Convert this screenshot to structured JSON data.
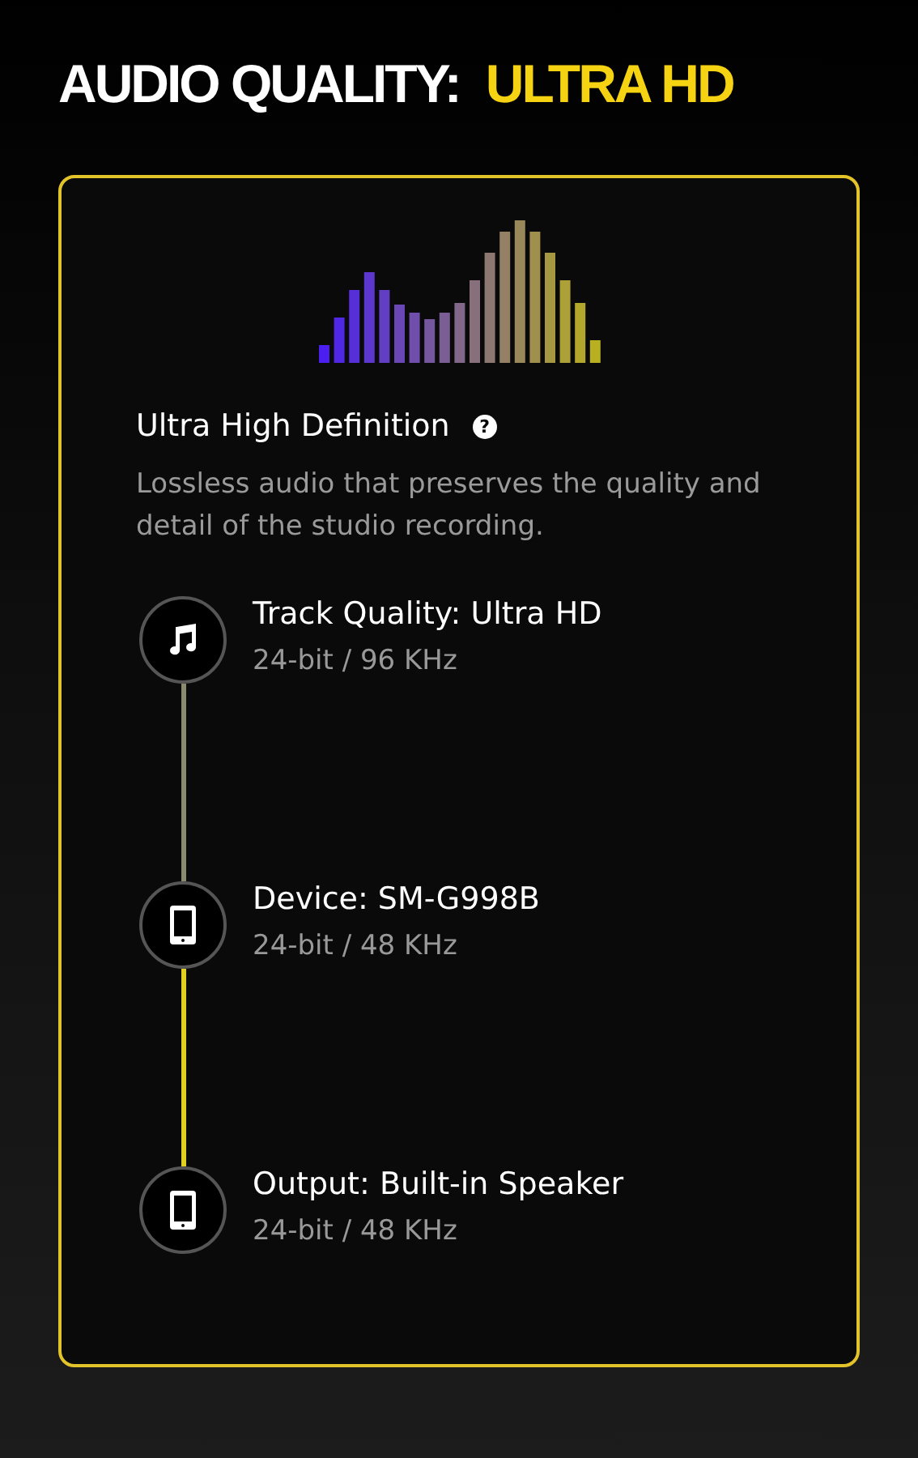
{
  "title": {
    "label": "AUDIO QUALITY:",
    "value": "ULTRA HD"
  },
  "card": {
    "heading": "Ultra High Definition",
    "help": "?",
    "description": "Lossless audio that preserves the quality and detail of the studio recording.",
    "steps": [
      {
        "kind": "music",
        "label": "Track Quality: Ultra HD",
        "detail": "24-bit / 96 KHz",
        "color": "#8a8a70"
      },
      {
        "kind": "device",
        "label": "Device: SM-G998B",
        "detail": "24-bit / 48 KHz",
        "color": "#e0d020"
      },
      {
        "kind": "device",
        "label": "Output: Built-in Speaker",
        "detail": "24-bit / 48 KHz"
      }
    ]
  }
}
